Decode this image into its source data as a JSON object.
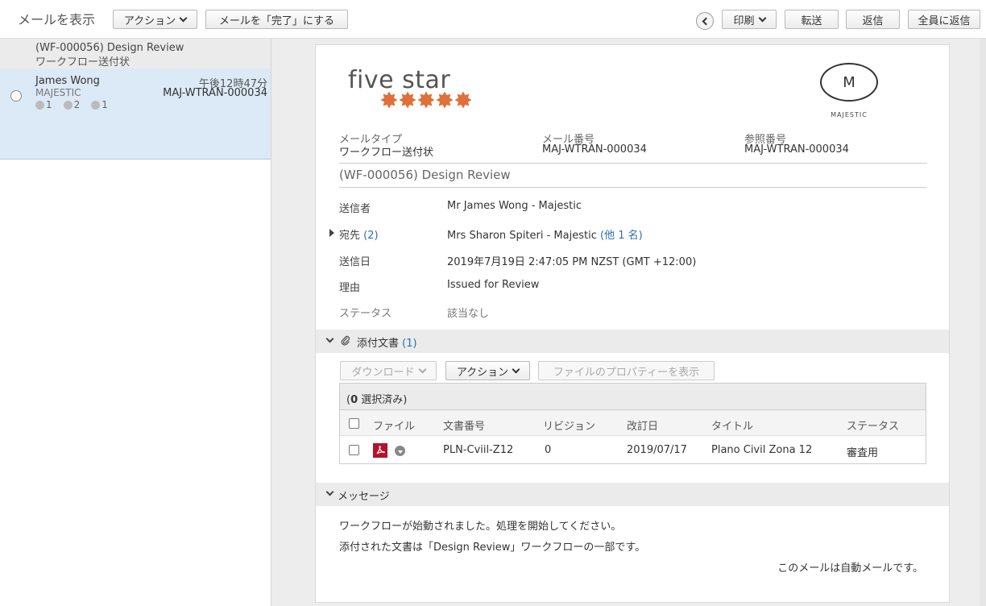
{
  "toolbar": {
    "title": "メールを表示",
    "action_label": "アクション",
    "complete_label": "メールを「完了」にする",
    "print_label": "印刷",
    "forward_label": "転送",
    "reply_label": "返信",
    "reply_all_label": "全員に返信"
  },
  "thread": {
    "subject": "(WF-000056) Design Review",
    "type": "ワークフロー送付状"
  },
  "message_item": {
    "sender": "James Wong",
    "org": "MAJESTIC",
    "time": "午後12時47分",
    "number": "MAJ-WTRAN-000034",
    "counts": [
      "1",
      "2",
      "1"
    ]
  },
  "logos": {
    "brand_text": "five star",
    "star_color": "#e0703a",
    "majestic_mark": "M",
    "majestic_name": "MAJESTIC"
  },
  "meta": {
    "mail_type_label": "メールタイプ",
    "mail_type_value": "ワークフロー送付状",
    "mail_no_label": "メール番号",
    "mail_no_value": "MAJ-WTRAN-000034",
    "ref_no_label": "参照番号",
    "ref_no_value": "MAJ-WTRAN-000034"
  },
  "mail": {
    "subject": "(WF-000056) Design Review",
    "from_label": "送信者",
    "from_value": "Mr James Wong - Majestic",
    "to_label": "宛先",
    "to_count": "(2)",
    "to_value": "Mrs Sharon Spiteri - Majestic",
    "to_more": "(他 1 名)",
    "date_label": "送信日",
    "date_value": "2019年7月19日 2:47:05 PM NZST (GMT +12:00)",
    "reason_label": "理由",
    "reason_value": "Issued for Review",
    "status_label": "ステータス",
    "status_value": "該当なし"
  },
  "attachments": {
    "section_label": "添付文書",
    "count": "(1)",
    "download_label": "ダウンロード",
    "action_label": "アクション",
    "properties_label": "ファイルのプロパティーを表示",
    "selected_count": "0",
    "selected_text": "選択済み)",
    "selected_open": "(",
    "columns": [
      "ファイル",
      "文書番号",
      "リビジョン",
      "改訂日",
      "タイトル",
      "ステータス"
    ],
    "rows": [
      {
        "doc_no": "PLN-Cviil-Z12",
        "revision": "0",
        "revised": "2019/07/17",
        "title": "Plano Civil Zona 12",
        "status": "審査用"
      }
    ]
  },
  "message": {
    "section_label": "メッセージ",
    "line1": "ワークフローが始動されました。処理を開始してください。",
    "line2": "添付された文書は「Design Review」ワークフローの一部です。",
    "auto_note": "このメールは自動メールです。"
  }
}
